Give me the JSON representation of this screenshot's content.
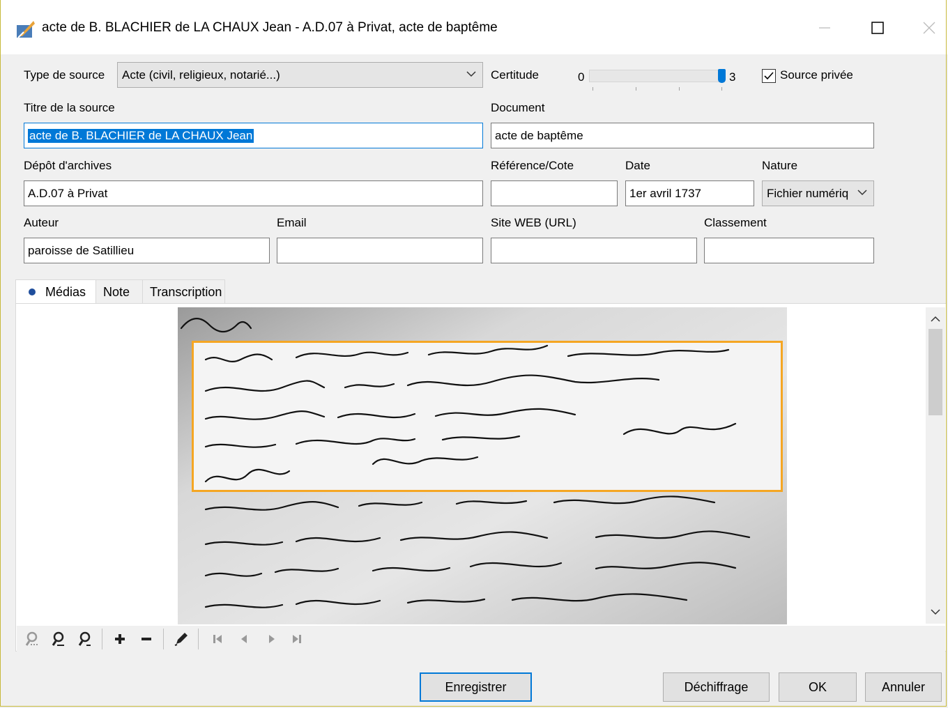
{
  "window": {
    "title": "acte de B. BLACHIER de LA CHAUX Jean - A.D.07 à Privat, acte de baptême",
    "minimize_icon": "minimize-icon",
    "maximize_icon": "maximize-icon",
    "close_icon": "close-icon"
  },
  "form": {
    "type_source_label": "Type de source",
    "type_source_value": "Acte (civil, religieux, notarié...)",
    "certitude_label": "Certitude",
    "certitude_min": "0",
    "certitude_max": "3",
    "certitude_value": 3,
    "source_privee_label": "Source privée",
    "source_privee_checked": true,
    "titre_label": "Titre de la source",
    "titre_value": "acte de B. BLACHIER de LA CHAUX Jean",
    "document_label": "Document",
    "document_value": "acte de baptême",
    "depot_label": "Dépôt d'archives",
    "depot_value": "A.D.07 à Privat",
    "reference_label": "Référence/Cote",
    "reference_value": "",
    "date_label": "Date",
    "date_value": "1er avril 1737",
    "nature_label": "Nature",
    "nature_value": "Fichier numériq",
    "auteur_label": "Auteur",
    "auteur_value": "paroisse de Satillieu",
    "email_label": "Email",
    "email_value": "",
    "site_label": "Site WEB (URL)",
    "site_value": "",
    "classement_label": "Classement",
    "classement_value": ""
  },
  "tabs": [
    {
      "label": "Médias",
      "active": true
    },
    {
      "label": "Note",
      "active": false
    },
    {
      "label": "Transcription",
      "active": false
    }
  ],
  "media": {
    "image_icon": "handwritten-register-scan",
    "highlight_color": "#f5a623"
  },
  "toolbar": {
    "icons": [
      "zoom-fit-icon",
      "zoom-in-icon",
      "zoom-out-icon",
      "add-icon",
      "remove-icon",
      "edit-icon",
      "first-icon",
      "previous-icon",
      "next-icon",
      "last-icon"
    ]
  },
  "buttons": {
    "enregistrer": "Enregistrer",
    "dechiffrage": "Déchiffrage",
    "ok": "OK",
    "annuler": "Annuler"
  },
  "colors": {
    "accent": "#0078d7",
    "frame": "#c7b93a"
  }
}
